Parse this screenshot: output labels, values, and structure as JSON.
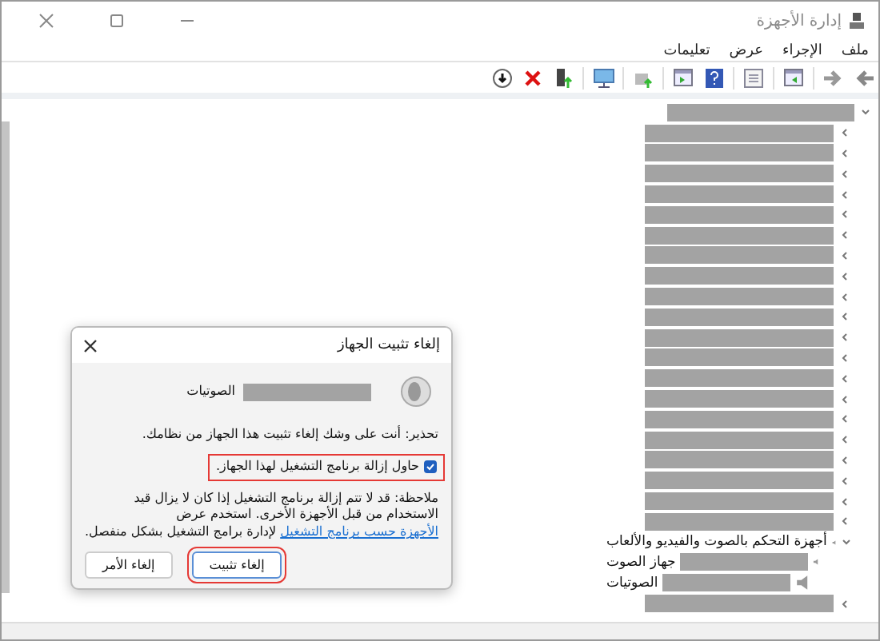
{
  "window": {
    "title": "إدارة الأجهزة"
  },
  "menu": [
    "ملف",
    "الإجراء",
    "عرض",
    "تعليمات"
  ],
  "tree": {
    "kind": "redacted",
    "expanded": true,
    "children": [
      {
        "kind": "redacted",
        "expanded": false
      },
      {
        "kind": "redacted",
        "expanded": false
      },
      {
        "kind": "redacted",
        "expanded": false
      },
      {
        "kind": "redacted",
        "expanded": false
      },
      {
        "kind": "redacted",
        "expanded": false
      },
      {
        "kind": "redacted",
        "expanded": false
      },
      {
        "kind": "redacted",
        "expanded": false
      },
      {
        "kind": "redacted",
        "expanded": false
      },
      {
        "kind": "redacted",
        "expanded": false
      },
      {
        "kind": "redacted",
        "expanded": false
      },
      {
        "kind": "redacted",
        "expanded": false
      },
      {
        "kind": "redacted",
        "expanded": false
      },
      {
        "kind": "redacted",
        "expanded": false
      },
      {
        "kind": "redacted",
        "expanded": false
      },
      {
        "kind": "redacted",
        "expanded": false
      },
      {
        "kind": "redacted",
        "expanded": false
      },
      {
        "kind": "redacted",
        "expanded": false
      },
      {
        "kind": "redacted",
        "expanded": false
      },
      {
        "kind": "redacted",
        "expanded": false
      },
      {
        "kind": "redacted",
        "expanded": false
      },
      {
        "kind": "group",
        "label": "أجهزة التحكم بالصوت والفيديو والألعاب",
        "expanded": true,
        "children": [
          {
            "kind": "device",
            "label": "جهاز الصوت"
          },
          {
            "kind": "device",
            "label": "الصوتيات"
          }
        ]
      },
      {
        "kind": "redacted",
        "expanded": false
      }
    ]
  },
  "dialog": {
    "title": "إلغاء تثبيت الجهاز",
    "device": "الصوتيات",
    "warning": "تحذير: أنت على وشك إلغاء تثبيت هذا الجهاز من نظامك.",
    "checkbox": {
      "label": "حاول إزالة برنامج التشغيل لهذا الجهاز.",
      "checked": true,
      "highlighted": true
    },
    "note": {
      "before": "ملاحظة: قد لا تتم إزالة برنامج التشغيل إذا كان لا يزال قيد الاستخدام من قبل الأجهزة الأخرى. استخدم عرض",
      "link": "الأجهزة حسب برنامج التشغيل",
      "after": "لإدارة برامج التشغيل بشكل منفصل."
    },
    "buttons": [
      {
        "label": "إلغاء تثبيت",
        "primary": true,
        "highlighted": true
      },
      {
        "label": "إلغاء الأمر",
        "primary": false
      }
    ]
  }
}
